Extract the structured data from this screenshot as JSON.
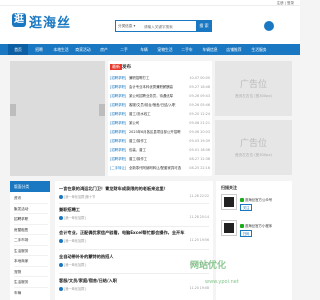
{
  "topbar": {
    "links": "注册 | 登录"
  },
  "brand": {
    "logo_mark": "逛",
    "name": "逛海丝"
  },
  "search": {
    "category": "分类信息 ▾",
    "placeholder": "请输入关键字搜索",
    "button": "搜 索"
  },
  "nav": {
    "items": [
      "首页",
      "招聘",
      "本地生活",
      "商家活动",
      "房产",
      "二手",
      "车辆",
      "宠物生活",
      "二手车",
      "车辆信息",
      "店铺推荐",
      "生活服务"
    ]
  },
  "news": {
    "tag": "最新",
    "title": "发布",
    "items": [
      {
        "cat": "[招聘求职]",
        "text": "兼职招聘打工",
        "date": "10-07 00:00"
      },
      {
        "cat": "[招聘求职]",
        "text": "会计专业本科优秀兼职薪酬高",
        "date": "09-27 18:48"
      },
      {
        "cat": "[招聘求职]",
        "text": "某公司招聘业务员，待遇优厚",
        "date": "09-26 09:43"
      },
      {
        "cat": "[招聘求职]",
        "text": "客服/文员/前台/宿舍/日结/入职",
        "date": "09-26 05:46"
      },
      {
        "cat": "[招聘求职]",
        "text": "普工/流水线工",
        "date": "09-20 12:24"
      },
      {
        "cat": "[招聘求职]",
        "text": "某公司",
        "date": "09-06 21:21"
      },
      {
        "cat": "[招聘求职]",
        "text": "2023年6月各区县项目部公开招聘",
        "date": "09-06 20:03"
      },
      {
        "cat": "[招聘求职]",
        "text": "普工/操作工",
        "date": "09-03 19:39"
      },
      {
        "cat": "[招聘求职]",
        "text": "包装、普工",
        "date": "09-01 18:08"
      },
      {
        "cat": "[招聘求职]",
        "text": "普工/操作工",
        "date": "08-27 12:36"
      },
      {
        "cat": "[二手转让]",
        "text": "全新零代阿赫阿转让/配套家具可选",
        "date": "08-25 22:16"
      }
    ]
  },
  "ads": [
    {
      "main": "广告位",
      "sub": "首页左右位 (宽300px)"
    },
    {
      "main": "广告位",
      "sub": "首页左右位 (宽300px)"
    }
  ],
  "sidebar": {
    "heading": "版面分类",
    "items": [
      "资讯",
      "聚发活动",
      "招聘求职",
      "房屋租售",
      "二手市场",
      "生活服务",
      "本地商家",
      "宠物",
      "生活服务",
      "车辆",
      "汽车服务"
    ]
  },
  "feed": {
    "posts": [
      {
        "title": "一言在泉的鸿运北门卫！青龙财车成泉限的的老板来这里！",
        "author": "[我一辈化加群]第十节",
        "time": "11-28 22:22"
      },
      {
        "title": "兼职招聘工",
        "author": "[我一辈化加群]",
        "time": "11-28 20:14"
      },
      {
        "title": "会计专业，正配偶优家信产验看，电脑Excel帮忙都会操作，全开车",
        "author": "[我一辈化加群]",
        "time": "11-25 19:56"
      },
      {
        "title": "全自动带补补的蒙特的热招人",
        "author": "[我一辈化加群]",
        "time": "11-23 19:53"
      },
      {
        "title": "客服/文员/家庭/宿舍/日结/入职",
        "author": "[我一辈化加群]",
        "time": "11-20 19:08"
      }
    ]
  },
  "right_panel": {
    "title": "扫描关注",
    "rows": [
      {
        "label": "逛海丝官方公众号",
        "button": "关注"
      },
      {
        "label": "逛海丝官方小程序",
        "button": "扫码"
      }
    ]
  },
  "watermark": {
    "main": "网站优化",
    "sub": "www.ypoi.net"
  }
}
